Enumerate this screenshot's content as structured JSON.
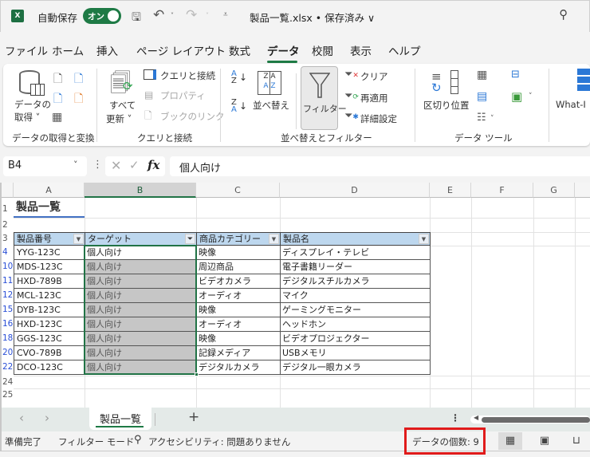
{
  "titlebar": {
    "autosave_label": "自動保存",
    "autosave_state": "オン",
    "filename": "製品一覧.xlsx • 保存済み ∨",
    "icons": [
      "excel-logo",
      "save-icon",
      "undo-icon",
      "redo-icon",
      "customize-qat-icon",
      "search-icon"
    ]
  },
  "menu": {
    "tabs": [
      "ファイル",
      "ホーム",
      "挿入",
      "ページ レイアウト",
      "数式",
      "データ",
      "校閲",
      "表示",
      "ヘルプ"
    ],
    "active": "データ"
  },
  "ribbon": {
    "get_data": {
      "button": "データの",
      "button2": "取得 ˅",
      "group_label": "データの取得と変換"
    },
    "queries": {
      "refresh_all_1": "すべて",
      "refresh_all_2": "更新 ˅",
      "queries_connections": "クエリと接続",
      "properties": "プロパティ",
      "workbook_links": "ブックのリンク",
      "group_label": "クエリと接続"
    },
    "sort_filter": {
      "sort": "並べ替え",
      "filter": "フィルター",
      "clear": "クリア",
      "reapply": "再適用",
      "advanced": "詳細設定",
      "group_label": "並べ替えとフィルター"
    },
    "data_tools": {
      "text_to_columns": "区切り位置",
      "group_label": "データ ツール"
    },
    "forecast": {
      "what_if": "What-I"
    }
  },
  "formula_bar": {
    "name_box": "B4",
    "fx": "fx",
    "value": "個人向け"
  },
  "sheet": {
    "columns": [
      "A",
      "B",
      "C",
      "D",
      "E",
      "F",
      "G"
    ],
    "title_row": {
      "row": "1",
      "text": "製品一覧"
    },
    "empty_rows": [
      "2"
    ],
    "header_row": "3",
    "headers": [
      "製品番号",
      "ターゲット",
      "商品カテゴリー",
      "製品名"
    ],
    "rows": [
      {
        "row": "4",
        "cells": [
          "YYG-123C",
          "個人向け",
          "映像",
          "ディスプレイ・テレビ"
        ]
      },
      {
        "row": "10",
        "cells": [
          "MDS-123C",
          "個人向け",
          "周辺商品",
          "電子書籍リーダー"
        ]
      },
      {
        "row": "11",
        "cells": [
          "HXD-789B",
          "個人向け",
          "ビデオカメラ",
          "デジタルスチルカメラ"
        ]
      },
      {
        "row": "12",
        "cells": [
          "MCL-123C",
          "個人向け",
          "オーディオ",
          "マイク"
        ]
      },
      {
        "row": "15",
        "cells": [
          "DYB-123C",
          "個人向け",
          "映像",
          "ゲーミングモニター"
        ]
      },
      {
        "row": "16",
        "cells": [
          "HXD-123C",
          "個人向け",
          "オーディオ",
          "ヘッドホン"
        ]
      },
      {
        "row": "18",
        "cells": [
          "GGS-123C",
          "個人向け",
          "映像",
          "ビデオプロジェクター"
        ]
      },
      {
        "row": "20",
        "cells": [
          "CVO-789B",
          "個人向け",
          "記録メディア",
          "USBメモリ"
        ]
      },
      {
        "row": "22",
        "cells": [
          "DCO-123C",
          "個人向け",
          "デジタルカメラ",
          "デジタル一眼カメラ"
        ]
      }
    ],
    "trailing_rows": [
      "24",
      "25"
    ]
  },
  "sheet_tabs": {
    "prev": "‹",
    "next": "›",
    "active_tab": "製品一覧",
    "add": "+"
  },
  "status": {
    "ready": "準備完了",
    "filter_mode": "フィルター モード",
    "accessibility": "アクセシビリティ: 問題ありません",
    "count": "データの個数: 9",
    "highlight_color": "#e01b1b"
  }
}
